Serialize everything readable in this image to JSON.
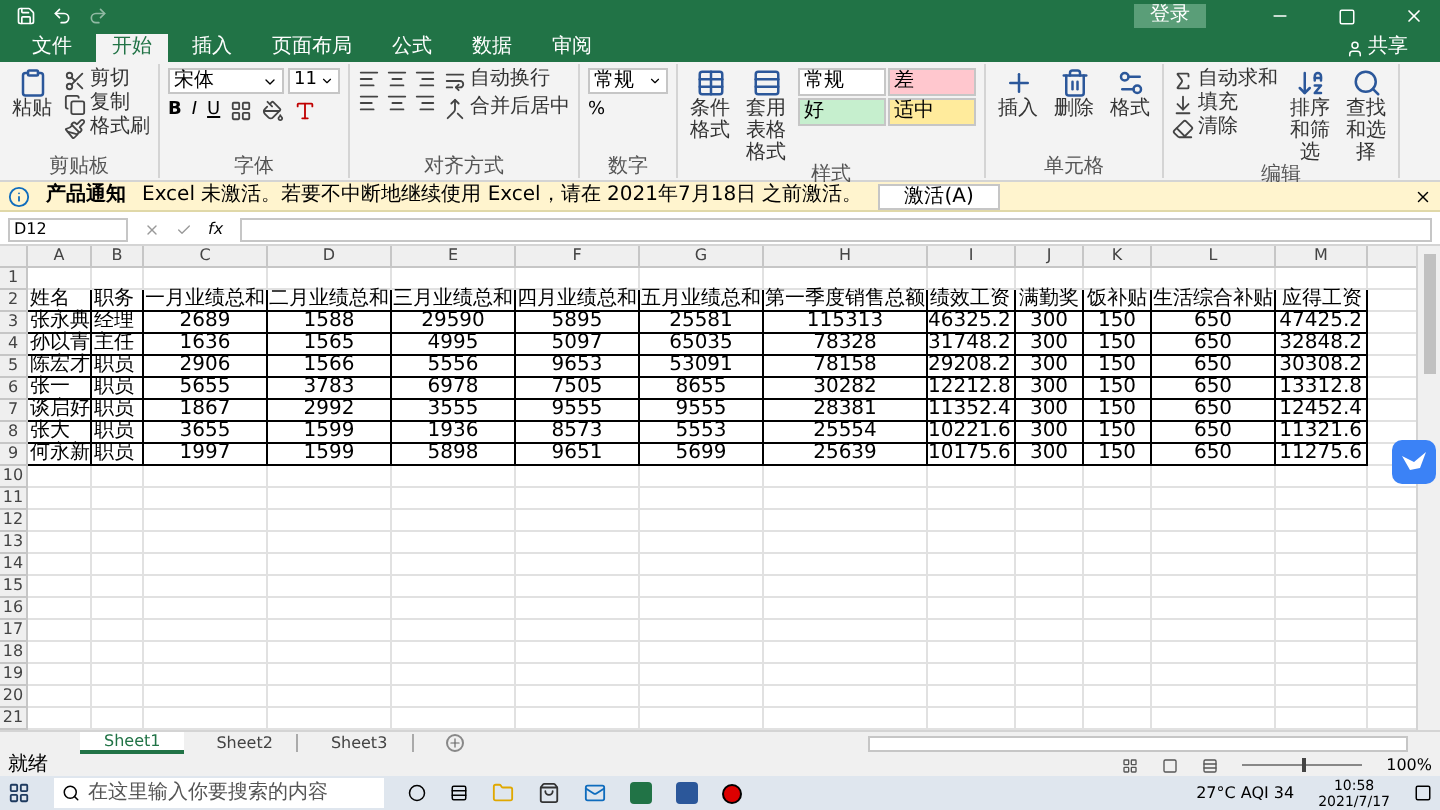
{
  "title_bar": {
    "login": "登录",
    "share": "共享"
  },
  "ribbon_tabs": [
    {
      "label": "文件",
      "selected": false
    },
    {
      "label": "开始",
      "selected": true
    },
    {
      "label": "插入",
      "selected": false
    },
    {
      "label": "页面布局",
      "selected": false
    },
    {
      "label": "公式",
      "selected": false
    },
    {
      "label": "数据",
      "selected": false
    },
    {
      "label": "审阅",
      "selected": false
    }
  ],
  "ribbon": {
    "clipboard": {
      "label": "剪贴板",
      "paste": "粘贴",
      "cut": "剪切",
      "copy": "复制",
      "format_painter": "格式刷"
    },
    "font": {
      "label": "字体",
      "family": "宋体",
      "size": "11",
      "bold": "B",
      "italic": "I",
      "underline": "U"
    },
    "alignment": {
      "label": "对齐方式",
      "wrap": "自动换行",
      "merge": "合并后居中"
    },
    "number": {
      "label": "数字",
      "format": "常规",
      "percent": "%"
    },
    "styles": {
      "label": "样式",
      "conditional": "条件格式",
      "table": "套用表格格式",
      "cells": [
        {
          "label": "常规",
          "color": "#ffffff"
        },
        {
          "label": "差",
          "color": "#ffc7ce"
        },
        {
          "label": "好",
          "color": "#c6efce"
        },
        {
          "label": "适中",
          "color": "#ffeb9c"
        }
      ]
    },
    "cells": {
      "label": "单元格",
      "insert": "插入",
      "delete": "删除",
      "format": "格式"
    },
    "editing": {
      "label": "编辑",
      "autosum": "自动求和",
      "fill": "填充",
      "clear": "清除",
      "sort": "排序和筛选",
      "find": "查找和选择"
    }
  },
  "notice": {
    "title": "产品通知",
    "text": "Excel 未激活。若要不中断地继续使用 Excel，请在 2021年7月18日 之前激活。",
    "button": "激活(A)"
  },
  "formula_bar": {
    "name_box": "D12",
    "fx": "fx"
  },
  "columns": [
    "A",
    "B",
    "C",
    "D",
    "E",
    "F",
    "G",
    "H",
    "I",
    "J",
    "K",
    "L",
    "M"
  ],
  "rows": [
    {
      "number": "1"
    },
    {
      "number": "2",
      "cells": [
        "姓名",
        "职务",
        "一月业绩总和",
        "二月业绩总和",
        "三月业绩总和",
        "四月业绩总和",
        "五月业绩总和",
        "第一季度销售总额",
        "绩效工资",
        "满勤奖",
        "饭补贴",
        "生活综合补贴",
        "应得工资"
      ]
    },
    {
      "number": "3",
      "cells": [
        "张永典",
        "经理",
        "2689",
        "1588",
        "29590",
        "5895",
        "25581",
        "115313",
        "46325.2",
        "300",
        "150",
        "650",
        "47425.2"
      ]
    },
    {
      "number": "4",
      "cells": [
        "孙以青",
        "主任",
        "1636",
        "1565",
        "4995",
        "5097",
        "65035",
        "78328",
        "31748.2",
        "300",
        "150",
        "650",
        "32848.2"
      ]
    },
    {
      "number": "5",
      "cells": [
        "陈宏才",
        "职员",
        "2906",
        "1566",
        "5556",
        "9653",
        "53091",
        "78158",
        "29208.2",
        "300",
        "150",
        "650",
        "30308.2"
      ]
    },
    {
      "number": "6",
      "cells": [
        "张一",
        "职员",
        "5655",
        "3783",
        "6978",
        "7505",
        "8655",
        "30282",
        "12212.8",
        "300",
        "150",
        "650",
        "13312.8"
      ]
    },
    {
      "number": "7",
      "cells": [
        "谈启好",
        "职员",
        "1867",
        "2992",
        "3555",
        "9555",
        "9555",
        "28381",
        "11352.4",
        "300",
        "150",
        "650",
        "12452.4"
      ]
    },
    {
      "number": "8",
      "cells": [
        "张大",
        "职员",
        "3655",
        "1599",
        "1936",
        "8573",
        "5553",
        "25554",
        "10221.6",
        "300",
        "150",
        "650",
        "11321.6"
      ]
    },
    {
      "number": "9",
      "cells": [
        "何永新",
        "职员",
        "1997",
        "1599",
        "5898",
        "9651",
        "5699",
        "25639",
        "10175.6",
        "300",
        "150",
        "650",
        "11275.6"
      ]
    },
    {
      "number": "10"
    },
    {
      "number": "11"
    },
    {
      "number": "12"
    },
    {
      "number": "13"
    },
    {
      "number": "14"
    },
    {
      "number": "15"
    },
    {
      "number": "16"
    },
    {
      "number": "17"
    },
    {
      "number": "18"
    },
    {
      "number": "19"
    },
    {
      "number": "20"
    },
    {
      "number": "21"
    }
  ],
  "sheet_tabs": [
    {
      "label": "Sheet1",
      "selected": true
    },
    {
      "label": "Sheet2",
      "selected": false
    },
    {
      "label": "Sheet3",
      "selected": false
    }
  ],
  "status_bar": {
    "text": "就绪",
    "zoom": {
      "level": 0.5,
      "reading": "100%"
    }
  },
  "taskbar": {
    "search_placeholder": "在这里输入你要搜索的内容",
    "weather": "27°C AQI 34",
    "time": "10:58",
    "date": "2021/7/17"
  }
}
